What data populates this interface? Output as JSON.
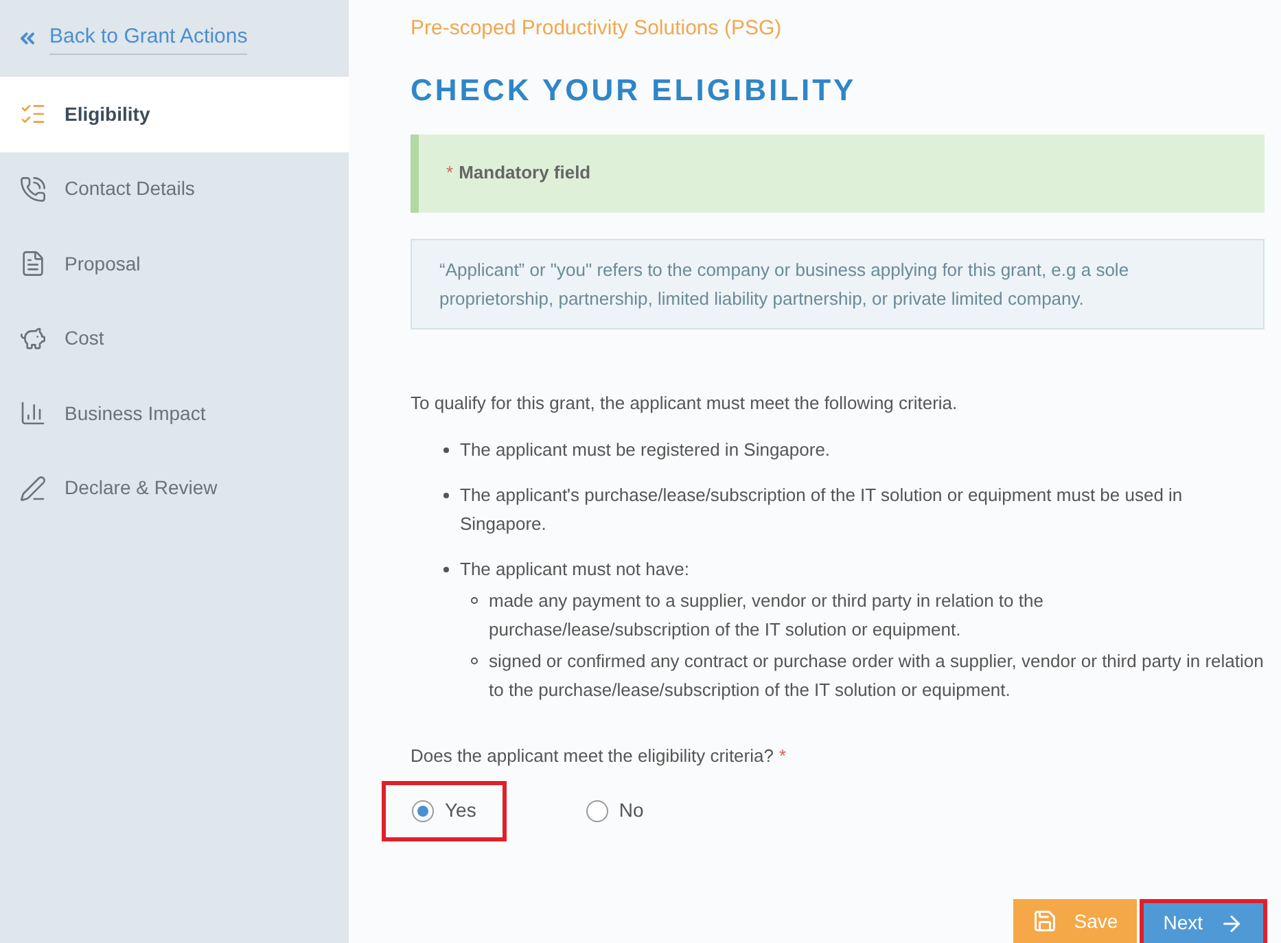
{
  "sidebar": {
    "back_link": "Back to Grant Actions",
    "items": [
      {
        "label": "Eligibility",
        "kind": "list",
        "selected": true
      },
      {
        "label": "Contact Details",
        "kind": "phone",
        "selected": false
      },
      {
        "label": "Proposal",
        "kind": "document",
        "selected": false
      },
      {
        "label": "Cost",
        "kind": "piggy",
        "selected": false
      },
      {
        "label": "Business Impact",
        "kind": "chart",
        "selected": false
      },
      {
        "label": "Declare & Review",
        "kind": "pen",
        "selected": false
      }
    ]
  },
  "main": {
    "subtitle": "Pre-scoped Productivity Solutions (PSG)",
    "title": "CHECK YOUR ELIGIBILITY",
    "mandatory_note": {
      "mark": "*",
      "text": "Mandatory field"
    },
    "info_note": "“Applicant” or \"you\" refers to the company or business applying for this grant, e.g a sole proprietorship, partnership, limited liability partnership, or private limited company.",
    "intro": "To qualify for this grant, the applicant must meet the following criteria.",
    "criteria": [
      {
        "text": "The applicant must be registered in Singapore."
      },
      {
        "text": "The applicant's purchase/lease/subscription of the IT solution or equipment must be used in Singapore."
      },
      {
        "text": "The applicant must not have:",
        "children": [
          {
            "text": "made any payment to a supplier, vendor or third party in relation to the purchase/lease/subscription of the IT solution or equipment."
          },
          {
            "text": "signed or confirmed any contract or purchase order with a supplier, vendor or third party in relation to the purchase/lease/subscription of the IT solution or equipment."
          }
        ]
      }
    ],
    "question": {
      "text": "Does the applicant meet the eligibility criteria?",
      "mark": "*",
      "options": [
        {
          "label": "Yes",
          "selected": true,
          "highlighted": true
        },
        {
          "label": "No",
          "selected": false,
          "highlighted": false
        }
      ]
    },
    "buttons": [
      {
        "label": "Save",
        "kind": "save",
        "highlighted": false
      },
      {
        "label": "Next",
        "kind": "next",
        "highlighted": true
      }
    ]
  }
}
